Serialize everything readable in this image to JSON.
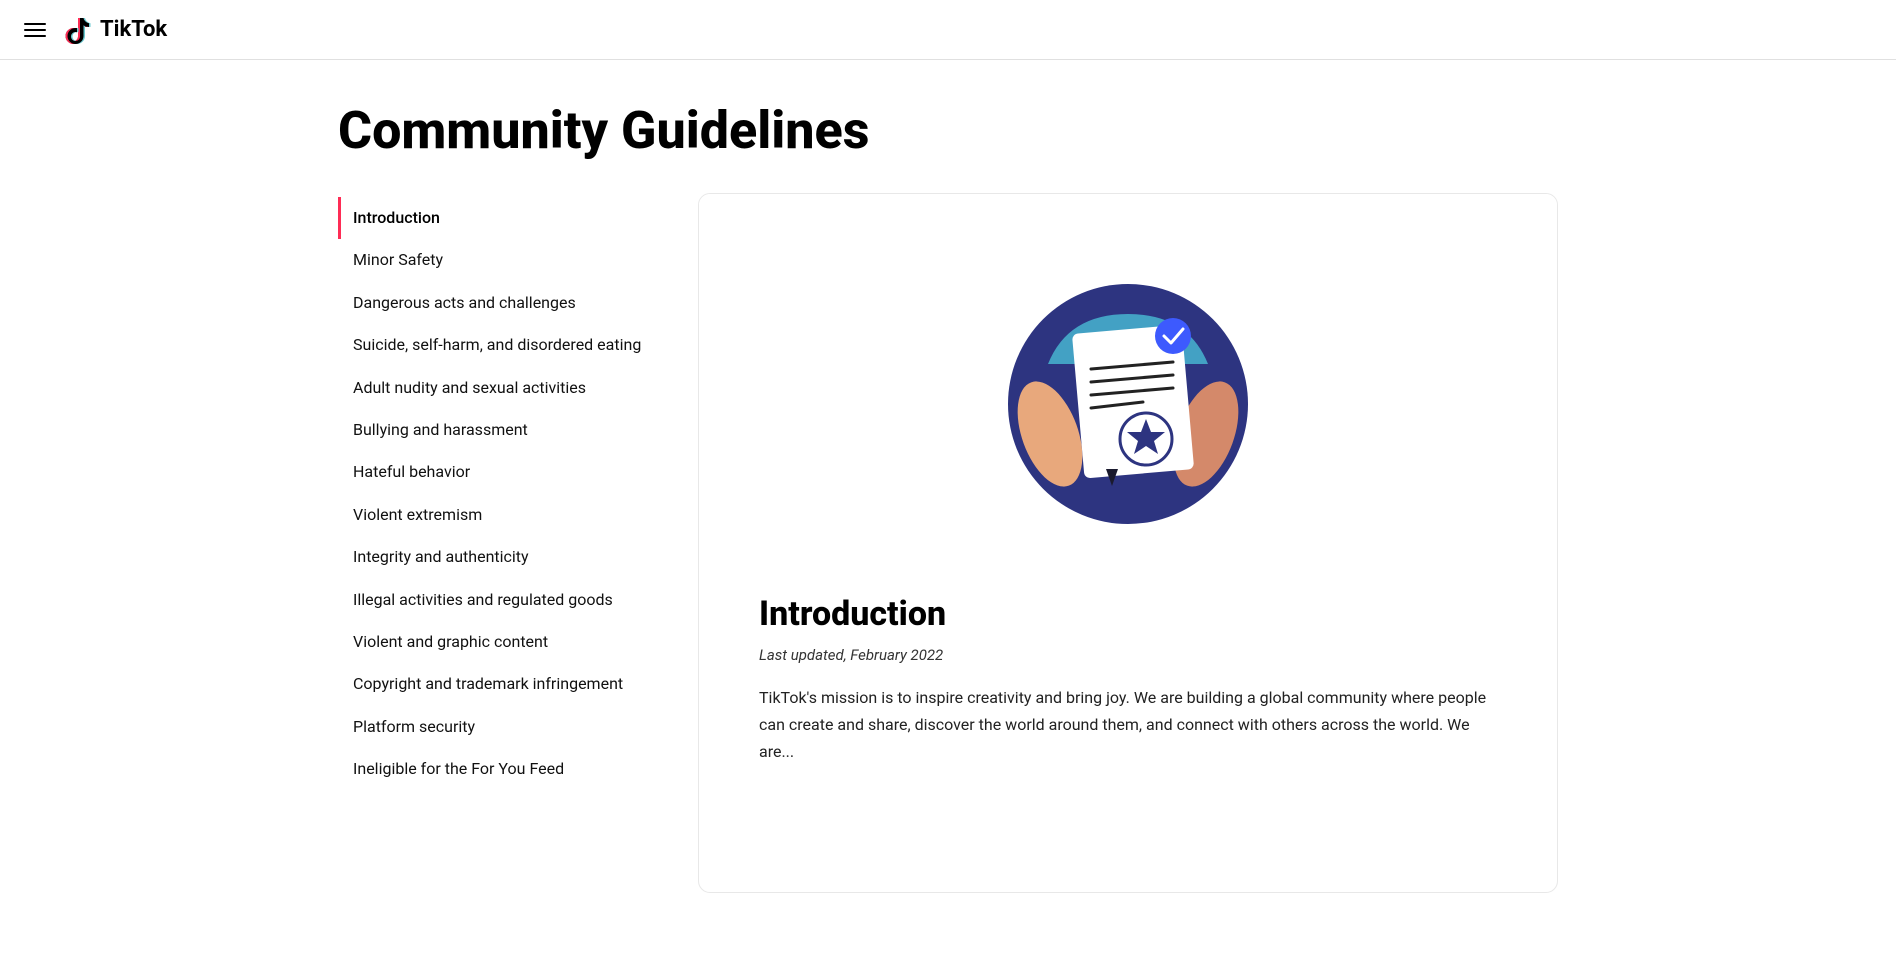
{
  "header": {
    "menu_label": "Menu",
    "logo_text": "TikTok"
  },
  "page": {
    "title": "Community Guidelines"
  },
  "sidebar": {
    "items": [
      {
        "id": "introduction",
        "label": "Introduction",
        "active": true
      },
      {
        "id": "minor-safety",
        "label": "Minor Safety",
        "active": false
      },
      {
        "id": "dangerous-acts",
        "label": "Dangerous acts and challenges",
        "active": false
      },
      {
        "id": "suicide-self-harm",
        "label": "Suicide, self-harm, and disordered eating",
        "active": false
      },
      {
        "id": "adult-nudity",
        "label": "Adult nudity and sexual activities",
        "active": false
      },
      {
        "id": "bullying",
        "label": "Bullying and harassment",
        "active": false
      },
      {
        "id": "hateful-behavior",
        "label": "Hateful behavior",
        "active": false
      },
      {
        "id": "violent-extremism",
        "label": "Violent extremism",
        "active": false
      },
      {
        "id": "integrity",
        "label": "Integrity and authenticity",
        "active": false
      },
      {
        "id": "illegal-activities",
        "label": "Illegal activities and regulated goods",
        "active": false
      },
      {
        "id": "violent-graphic",
        "label": "Violent and graphic content",
        "active": false
      },
      {
        "id": "copyright",
        "label": "Copyright and trademark infringement",
        "active": false
      },
      {
        "id": "platform-security",
        "label": "Platform security",
        "active": false
      },
      {
        "id": "ineligible-feed",
        "label": "Ineligible for the For You Feed",
        "active": false
      }
    ]
  },
  "main": {
    "section_title": "Introduction",
    "last_updated": "Last updated, February 2022",
    "intro_text": "TikTok's mission is to inspire creativity and bring joy. We are building a global community where people can create and share, discover the world around them, and connect with others across the world. We are..."
  },
  "colors": {
    "accent": "#fe2c55",
    "dark_blue": "#2d3480",
    "medium_blue": "#3d5afe",
    "light_blue": "#64b5f6",
    "teal": "#4dd0e1",
    "skin": "#e8a87c",
    "dark_skin": "#d4896a"
  }
}
